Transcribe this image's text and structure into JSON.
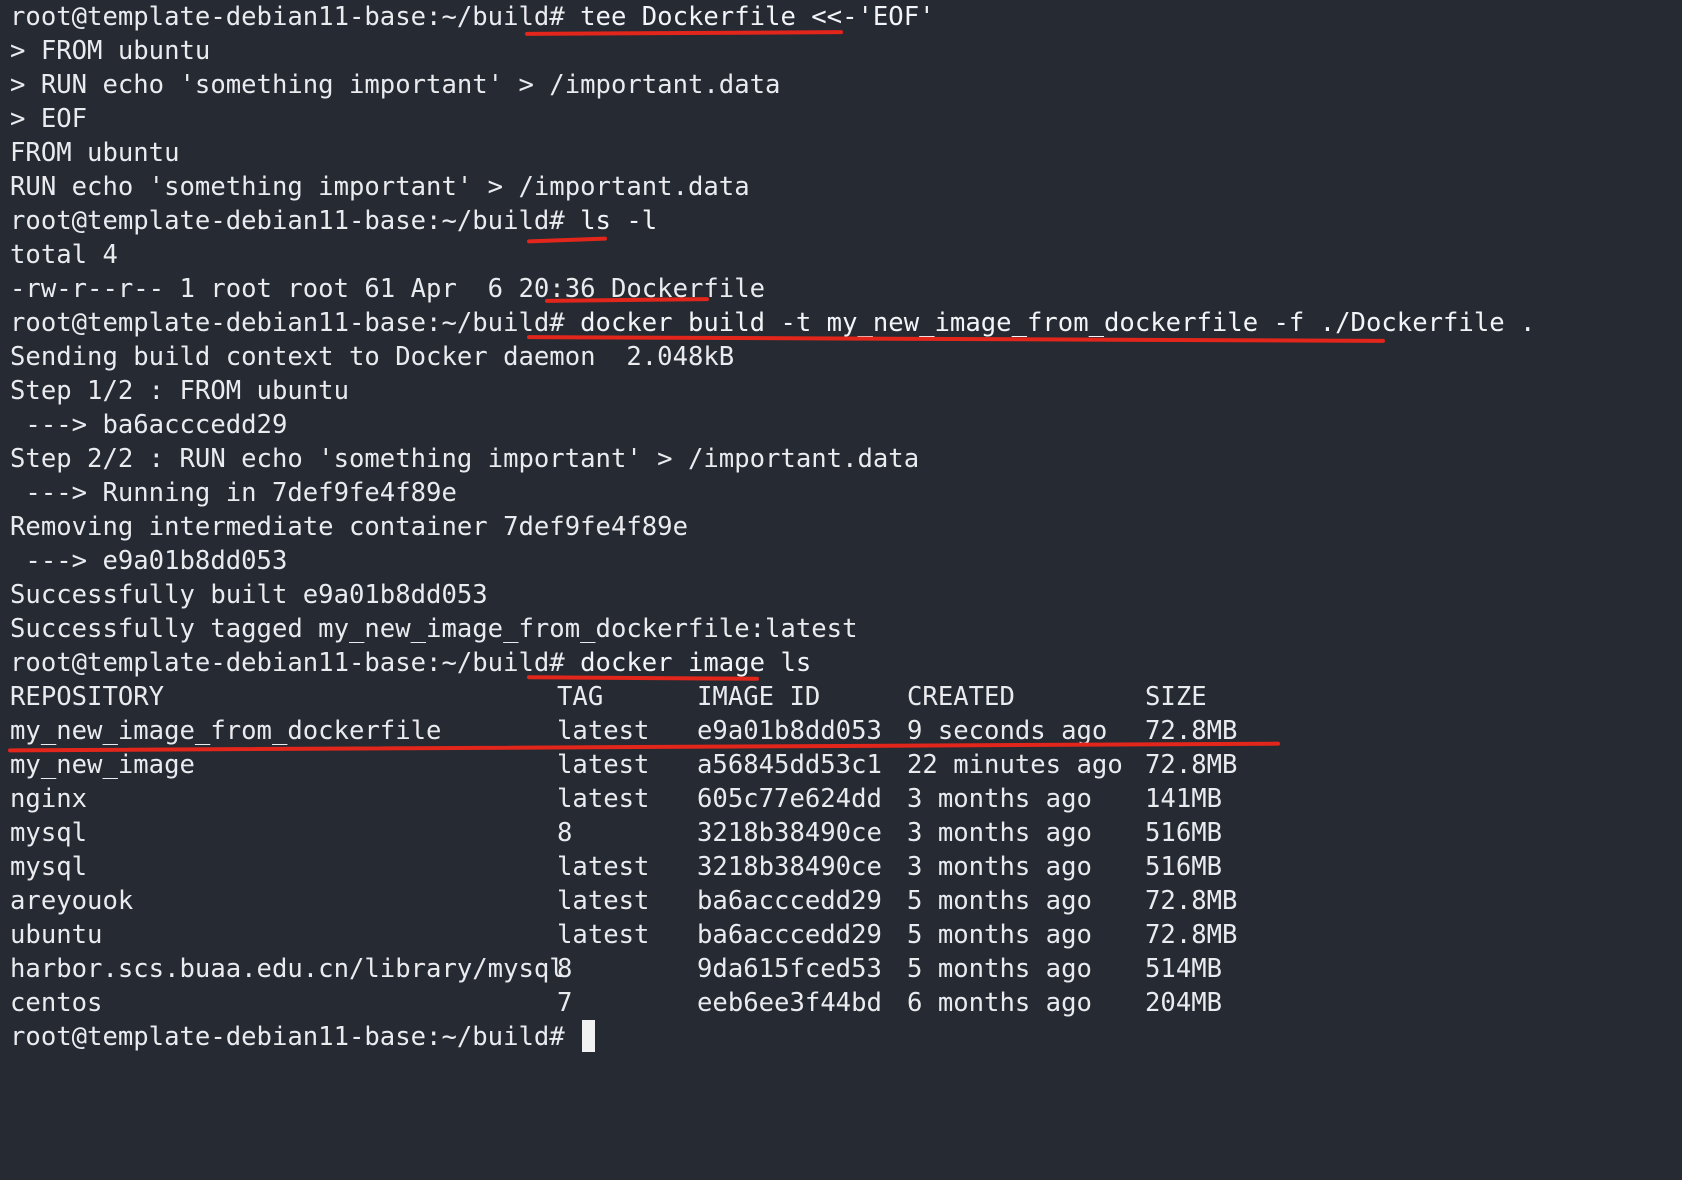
{
  "prompt": "root@template-debian11-base:~/build# ",
  "lines": [
    {
      "kind": "cmd",
      "text": "tee Dockerfile <<-'EOF'"
    },
    {
      "kind": "out",
      "text": "> FROM ubuntu"
    },
    {
      "kind": "out",
      "text": "> RUN echo 'something important' > /important.data"
    },
    {
      "kind": "out",
      "text": "> EOF"
    },
    {
      "kind": "out",
      "text": "FROM ubuntu"
    },
    {
      "kind": "out",
      "text": "RUN echo 'something important' > /important.data"
    },
    {
      "kind": "cmd",
      "text": "ls -l"
    },
    {
      "kind": "out",
      "text": "total 4"
    },
    {
      "kind": "out",
      "text": "-rw-r--r-- 1 root root 61 Apr  6 20:36 Dockerfile"
    },
    {
      "kind": "cmd",
      "text": "docker build -t my_new_image_from_dockerfile -f ./Dockerfile ."
    },
    {
      "kind": "out",
      "text": "Sending build context to Docker daemon  2.048kB"
    },
    {
      "kind": "out",
      "text": "Step 1/2 : FROM ubuntu"
    },
    {
      "kind": "out",
      "text": " ---> ba6acccedd29"
    },
    {
      "kind": "out",
      "text": "Step 2/2 : RUN echo 'something important' > /important.data"
    },
    {
      "kind": "out",
      "text": " ---> Running in 7def9fe4f89e"
    },
    {
      "kind": "out",
      "text": "Removing intermediate container 7def9fe4f89e"
    },
    {
      "kind": "out",
      "text": " ---> e9a01b8dd053"
    },
    {
      "kind": "out",
      "text": "Successfully built e9a01b8dd053"
    },
    {
      "kind": "out",
      "text": "Successfully tagged my_new_image_from_dockerfile:latest"
    },
    {
      "kind": "cmd",
      "text": "docker image ls"
    }
  ],
  "image_table": {
    "headers": [
      "REPOSITORY",
      "TAG",
      "IMAGE ID",
      "CREATED",
      "SIZE"
    ],
    "rows": [
      [
        "my_new_image_from_dockerfile",
        "latest",
        "e9a01b8dd053",
        "9 seconds ago",
        "72.8MB"
      ],
      [
        "my_new_image",
        "latest",
        "a56845dd53c1",
        "22 minutes ago",
        "72.8MB"
      ],
      [
        "nginx",
        "latest",
        "605c77e624dd",
        "3 months ago",
        "141MB"
      ],
      [
        "mysql",
        "8",
        "3218b38490ce",
        "3 months ago",
        "516MB"
      ],
      [
        "mysql",
        "latest",
        "3218b38490ce",
        "3 months ago",
        "516MB"
      ],
      [
        "areyouok",
        "latest",
        "ba6acccedd29",
        "5 months ago",
        "72.8MB"
      ],
      [
        "ubuntu",
        "latest",
        "ba6acccedd29",
        "5 months ago",
        "72.8MB"
      ],
      [
        "harbor.scs.buaa.edu.cn/library/mysql",
        "8",
        "9da615fced53",
        "5 months ago",
        "514MB"
      ],
      [
        "centos",
        "7",
        "eeb6ee3f44bd",
        "6 months ago",
        "204MB"
      ]
    ]
  },
  "colors": {
    "background": "#262a33",
    "text": "#e9ebef",
    "annotation_red": "#e3261b"
  }
}
